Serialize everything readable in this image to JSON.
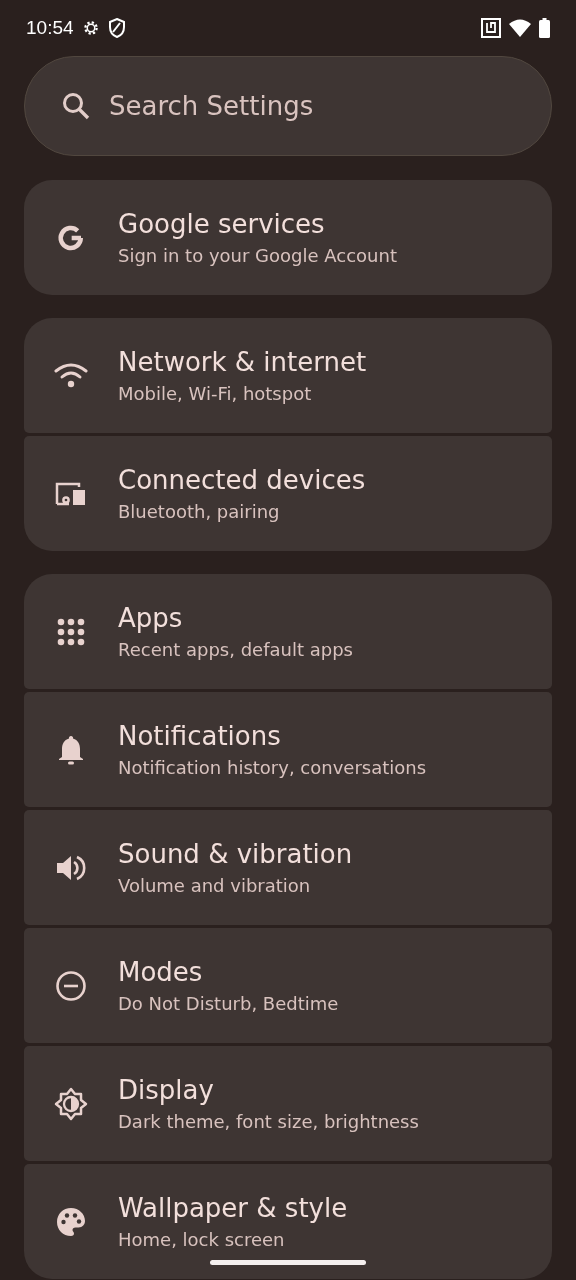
{
  "status_bar": {
    "time": "10:54"
  },
  "search": {
    "placeholder": "Search Settings"
  },
  "groups": [
    {
      "items": [
        {
          "kind": "google",
          "title": "Google services",
          "subtitle": "Sign in to your Google Account"
        }
      ]
    },
    {
      "items": [
        {
          "kind": "wifi",
          "title": "Network & internet",
          "subtitle": "Mobile, Wi-Fi, hotspot"
        },
        {
          "kind": "devices",
          "title": "Connected devices",
          "subtitle": "Bluetooth, pairing"
        }
      ]
    },
    {
      "items": [
        {
          "kind": "apps",
          "title": "Apps",
          "subtitle": "Recent apps, default apps"
        },
        {
          "kind": "bell",
          "title": "Notifications",
          "subtitle": "Notification history, conversations"
        },
        {
          "kind": "sound",
          "title": "Sound & vibration",
          "subtitle": "Volume and vibration"
        },
        {
          "kind": "modes",
          "title": "Modes",
          "subtitle": "Do Not Disturb, Bedtime"
        },
        {
          "kind": "display",
          "title": "Display",
          "subtitle": "Dark theme, font size, brightness"
        },
        {
          "kind": "palette",
          "title": "Wallpaper & style",
          "subtitle": "Home, lock screen"
        }
      ]
    }
  ]
}
